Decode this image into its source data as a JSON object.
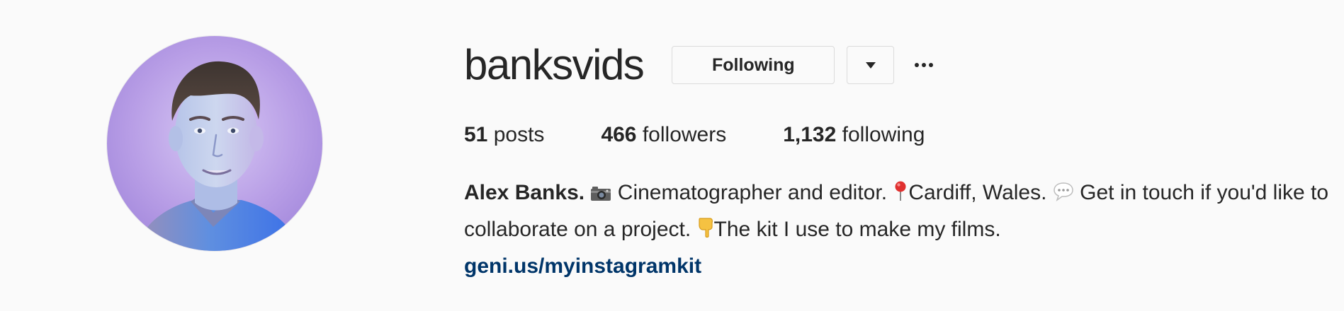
{
  "profile": {
    "username": "banksvids",
    "follow_button_label": "Following",
    "more_options_glyph": "•••",
    "stats": {
      "posts_count": "51",
      "posts_label": "posts",
      "followers_count": "466",
      "followers_label": "followers",
      "following_count": "1,132",
      "following_label": "following"
    },
    "bio": {
      "name": "Alex Banks.",
      "part1": "Cinematographer and editor.",
      "part2": "Cardiff, Wales.",
      "part3": "Get in touch if you'd like to collaborate on a project.",
      "part4": "The kit I use to make my films.",
      "link": "geni.us/myinstagramkit"
    }
  },
  "icons": {
    "bio_icon_1": "camera-icon",
    "bio_icon_2": "round-pushpin-icon",
    "bio_icon_3": "speech-bubble-icon",
    "bio_icon_4": "pointing-down-hand-icon",
    "dropdown": "caret-down-icon",
    "more": "ellipsis-icon"
  },
  "colors": {
    "background": "#fafafa",
    "text": "#262626",
    "link": "#003569",
    "button_border": "#dbdbdb",
    "avatar_background": "#b89ee6"
  }
}
